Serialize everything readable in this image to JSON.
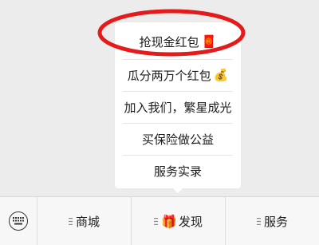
{
  "popup": {
    "items": [
      {
        "label": "抢现金红包",
        "emoji": "🧧"
      },
      {
        "label": "瓜分两万个红包",
        "emoji": "💰"
      },
      {
        "label": "加入我们，繁星成光",
        "emoji": ""
      },
      {
        "label": "买保险做公益",
        "emoji": ""
      },
      {
        "label": "服务实录",
        "emoji": ""
      }
    ]
  },
  "bottom_bar": {
    "keyboard_icon": "keyboard-icon",
    "menus": [
      {
        "label": "商城",
        "icon": "menu-lines-icon"
      },
      {
        "label": "发现",
        "icon": "gift-icon",
        "emoji": "🎁"
      },
      {
        "label": "服务",
        "icon": "menu-lines-icon"
      }
    ]
  },
  "colors": {
    "highlight": "#e31b1b",
    "background": "#ececec",
    "popup": "#ffffff"
  }
}
